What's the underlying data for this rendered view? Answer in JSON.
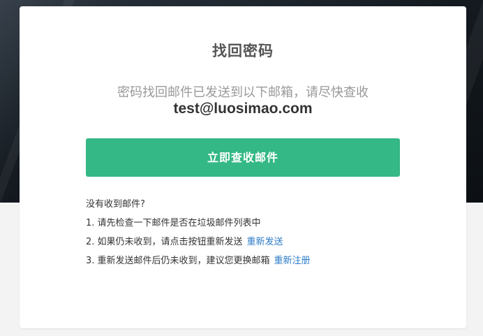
{
  "page": {
    "title": "找回密码",
    "notice": "密码找回邮件已发送到以下邮箱，请尽快查收",
    "email": "test@luosimao.com",
    "primary_button": "立即查收邮件"
  },
  "help": {
    "question": "没有收到邮件?",
    "item1": "1. 请先检查一下邮件是否在垃圾邮件列表中",
    "item2": "2. 如果仍未收到，请点击按钮重新发送",
    "item2_link": "重新发送",
    "item3": "3. 重新发送邮件后仍未收到，建议您更换邮箱",
    "item3_link": "重新注册"
  },
  "colors": {
    "accent": "#34b885",
    "link": "#2a7ac6",
    "hero_background": "#141a20",
    "page_background": "#f3f3f3"
  }
}
